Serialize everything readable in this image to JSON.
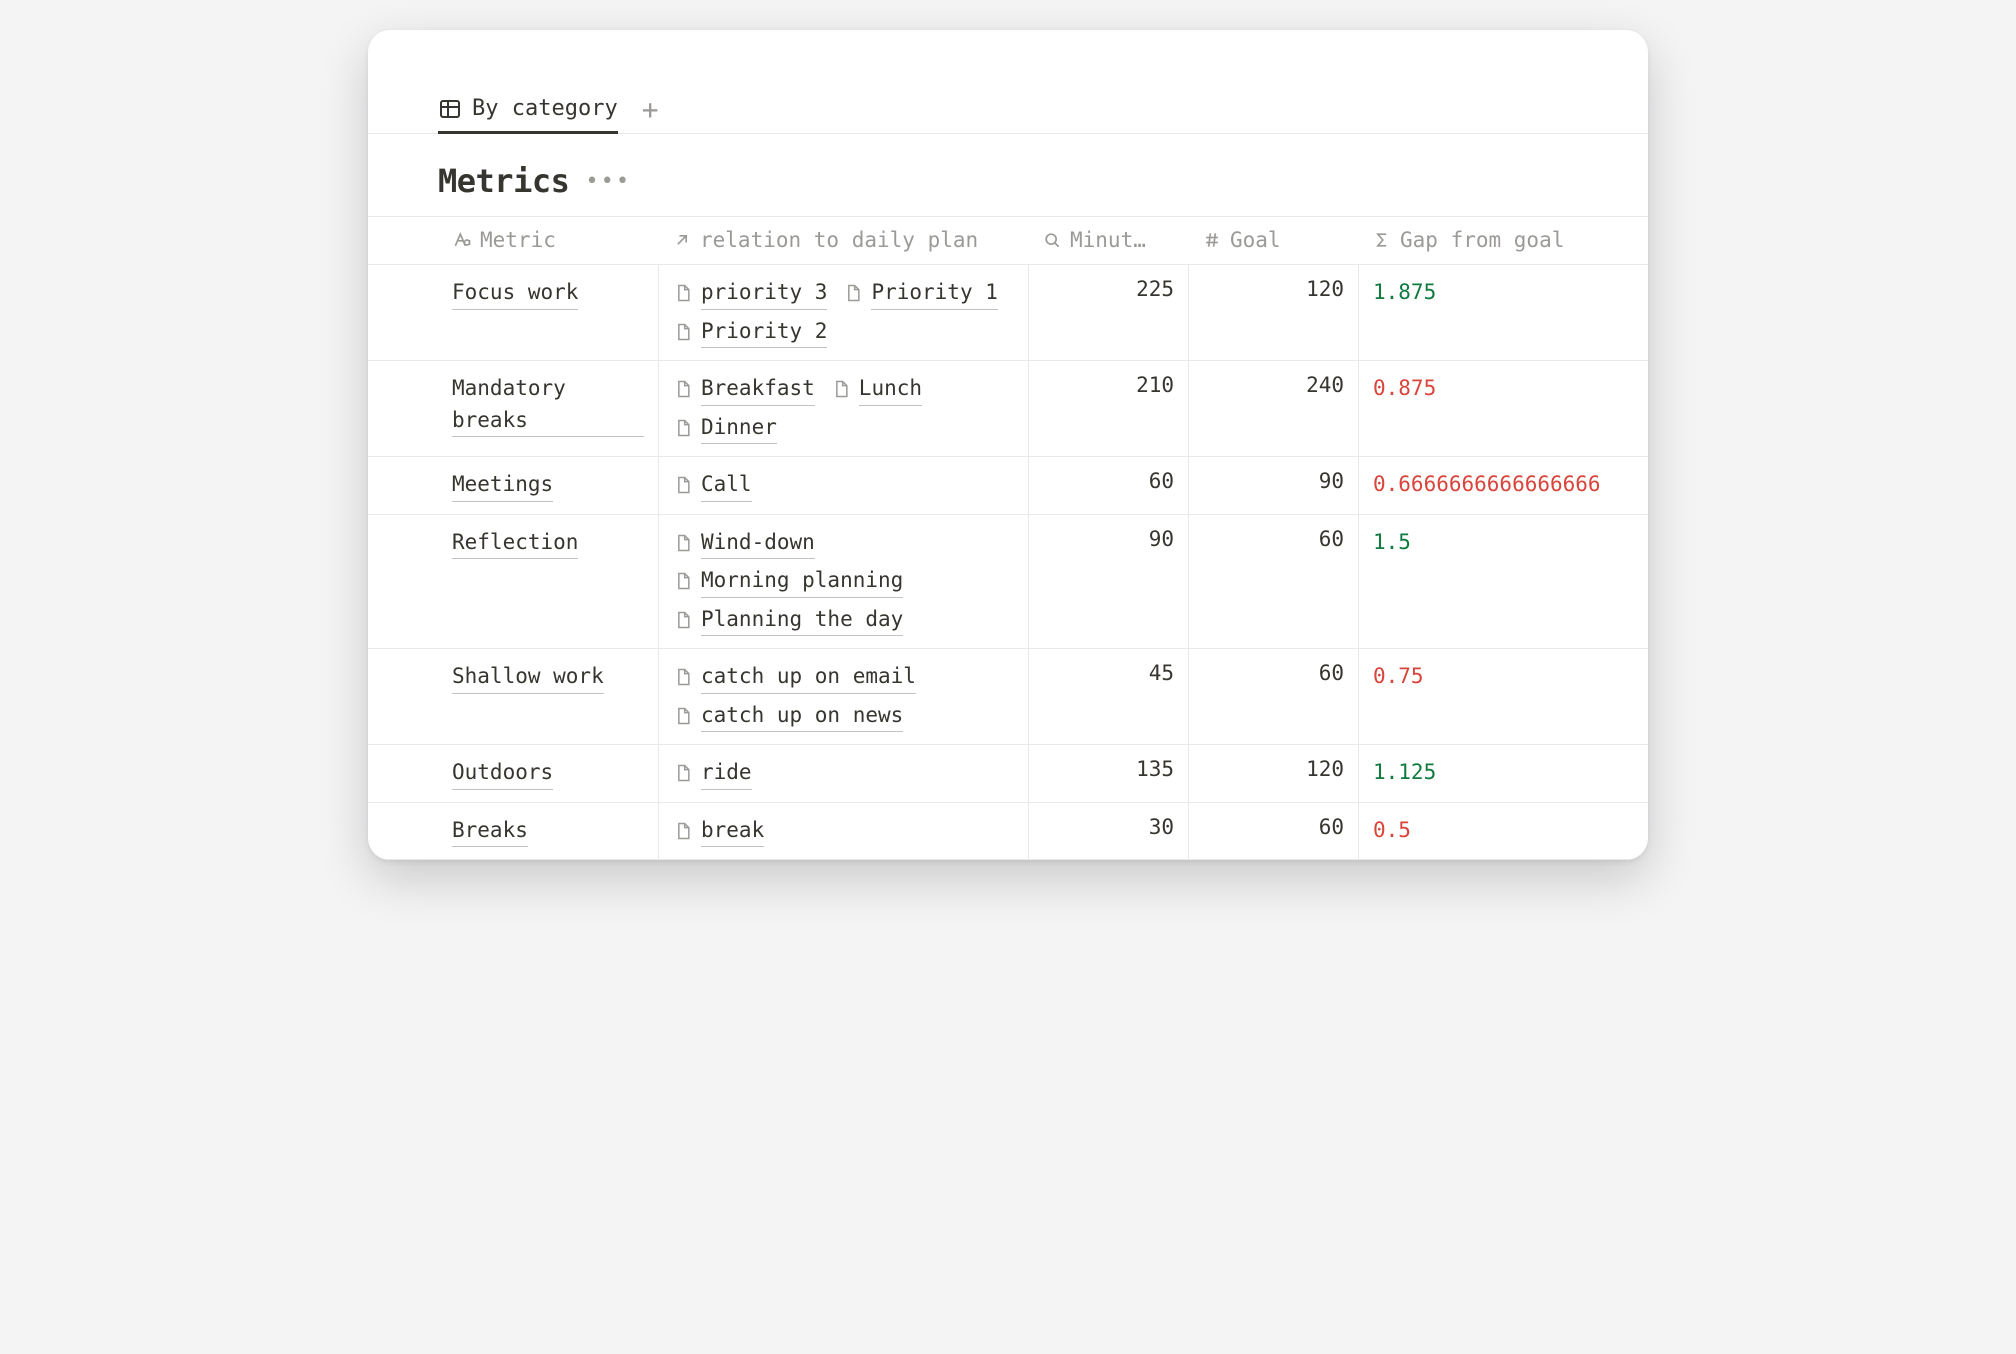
{
  "tabs": {
    "active": "By category",
    "add_label": "+"
  },
  "title": "Metrics",
  "columns": {
    "metric": "Metric",
    "relation": "relation to daily plan",
    "minutes": "Minut…",
    "goal": "Goal",
    "gap": "Gap from goal"
  },
  "rows": [
    {
      "metric": "Focus work",
      "relations": [
        "priority 3",
        "Priority 1",
        "Priority 2"
      ],
      "minutes": "225",
      "goal": "120",
      "gap": "1.875",
      "gap_sign": "pos"
    },
    {
      "metric": "Mandatory breaks",
      "relations": [
        "Breakfast",
        "Lunch",
        "Dinner"
      ],
      "minutes": "210",
      "goal": "240",
      "gap": "0.875",
      "gap_sign": "neg"
    },
    {
      "metric": "Meetings",
      "relations": [
        "Call"
      ],
      "minutes": "60",
      "goal": "90",
      "gap": "0.6666666666666666",
      "gap_sign": "neg"
    },
    {
      "metric": "Reflection",
      "relations": [
        "Wind-down",
        "Morning planning",
        "Planning the day"
      ],
      "minutes": "90",
      "goal": "60",
      "gap": "1.5",
      "gap_sign": "pos"
    },
    {
      "metric": "Shallow work",
      "relations": [
        "catch up on email",
        "catch up on news"
      ],
      "minutes": "45",
      "goal": "60",
      "gap": "0.75",
      "gap_sign": "neg"
    },
    {
      "metric": "Outdoors",
      "relations": [
        "ride"
      ],
      "minutes": "135",
      "goal": "120",
      "gap": "1.125",
      "gap_sign": "pos"
    },
    {
      "metric": "Breaks",
      "relations": [
        "break"
      ],
      "minutes": "30",
      "goal": "60",
      "gap": "0.5",
      "gap_sign": "neg"
    }
  ]
}
